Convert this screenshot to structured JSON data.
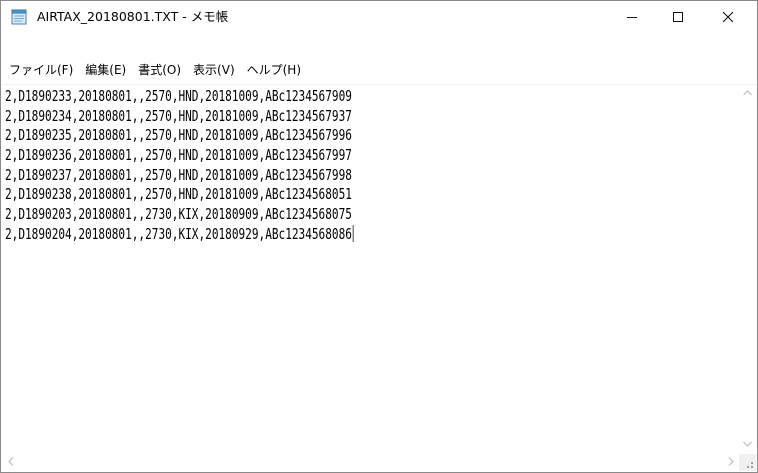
{
  "window": {
    "title": "AIRTAX_20180801.TXT - メモ帳"
  },
  "menu": {
    "items": [
      {
        "label": "ファイル(F)"
      },
      {
        "label": "編集(E)"
      },
      {
        "label": "書式(O)"
      },
      {
        "label": "表示(V)"
      },
      {
        "label": "ヘルプ(H)"
      }
    ]
  },
  "document": {
    "lines": [
      "2,D1890233,20180801,,2570,HND,20181009,ABc1234567909",
      "2,D1890234,20180801,,2570,HND,20181009,ABc1234567937",
      "2,D1890235,20180801,,2570,HND,20181009,ABc1234567996",
      "2,D1890236,20180801,,2570,HND,20181009,ABc1234567997",
      "2,D1890237,20180801,,2570,HND,20181009,ABc1234567998",
      "2,D1890238,20180801,,2570,HND,20181009,ABc1234568051",
      "2,D1890203,20180801,,2730,KIX,20180909,ABc1234568075",
      "2,D1890204,20180801,,2730,KIX,20180929,ABc1234568086"
    ]
  },
  "icons": {
    "app": "notepad-icon",
    "minimize": "minimize-icon",
    "maximize": "maximize-icon",
    "close": "close-icon"
  }
}
